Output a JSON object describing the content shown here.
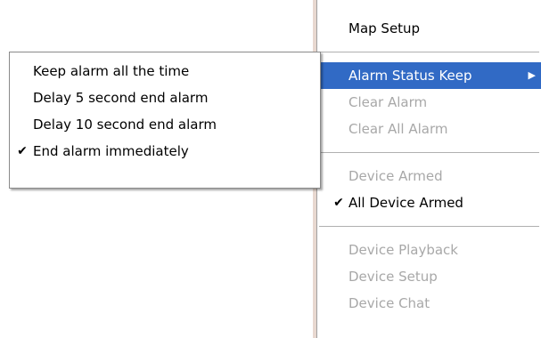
{
  "main_menu": {
    "map_setup": "Map Setup",
    "alarm_status_keep": "Alarm Status Keep",
    "submenu_arrow": "▶",
    "clear_alarm": "Clear Alarm",
    "clear_all_alarm": "Clear All Alarm",
    "device_armed": "Device Armed",
    "all_device_armed": "All Device Armed",
    "device_playback": "Device Playback",
    "device_setup": "Device Setup",
    "device_chat": "Device Chat",
    "check_mark": "✔"
  },
  "sub_menu": {
    "items": [
      {
        "label": "Keep alarm all the time"
      },
      {
        "label": "Delay 5 second end alarm"
      },
      {
        "label": "Delay 10 second end alarm"
      },
      {
        "label": "End alarm immediately"
      }
    ],
    "check_mark": "✔"
  },
  "colors": {
    "highlight": "#316ac5",
    "disabled_text": "#a8a8a8"
  }
}
